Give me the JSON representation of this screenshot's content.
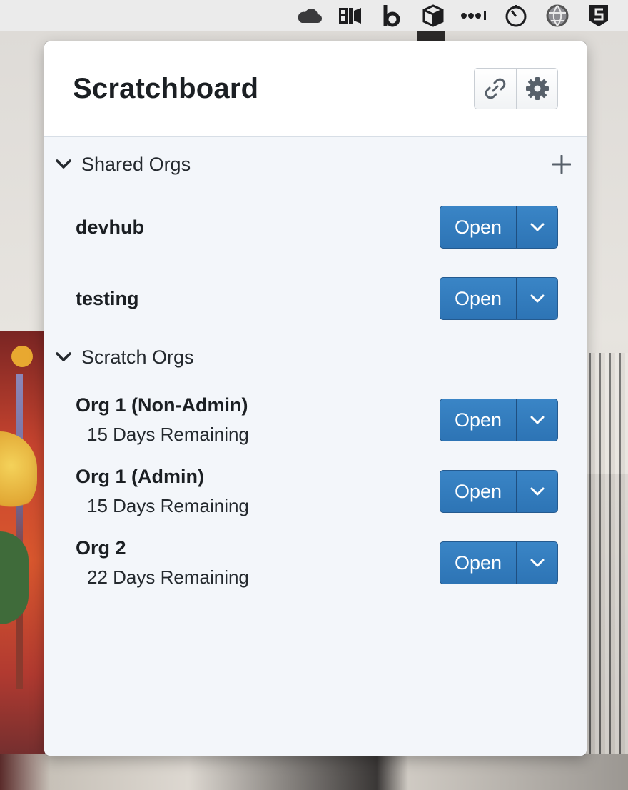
{
  "menubar": {
    "icons": [
      "cloud-icon",
      "bi-video-icon",
      "b-icon",
      "box-icon",
      "dots-icon",
      "timer-icon",
      "globe-icon",
      "s-shield-icon"
    ]
  },
  "popover": {
    "title": "Scratchboard",
    "header_buttons": [
      "link-icon",
      "gear-icon"
    ]
  },
  "shared": {
    "label": "Shared Orgs",
    "orgs": [
      {
        "name": "devhub",
        "button": "Open"
      },
      {
        "name": "testing",
        "button": "Open"
      }
    ]
  },
  "scratch": {
    "label": "Scratch Orgs",
    "orgs": [
      {
        "name": "Org 1 (Non-Admin)",
        "remaining": "15 Days Remaining",
        "button": "Open"
      },
      {
        "name": "Org 1 (Admin)",
        "remaining": "15 Days Remaining",
        "button": "Open"
      },
      {
        "name": "Org 2",
        "remaining": "22 Days Remaining",
        "button": "Open"
      }
    ]
  },
  "colors": {
    "primary": "#2d74b5",
    "panel_bg": "#f3f6fa",
    "header_bg": "#ffffff"
  }
}
